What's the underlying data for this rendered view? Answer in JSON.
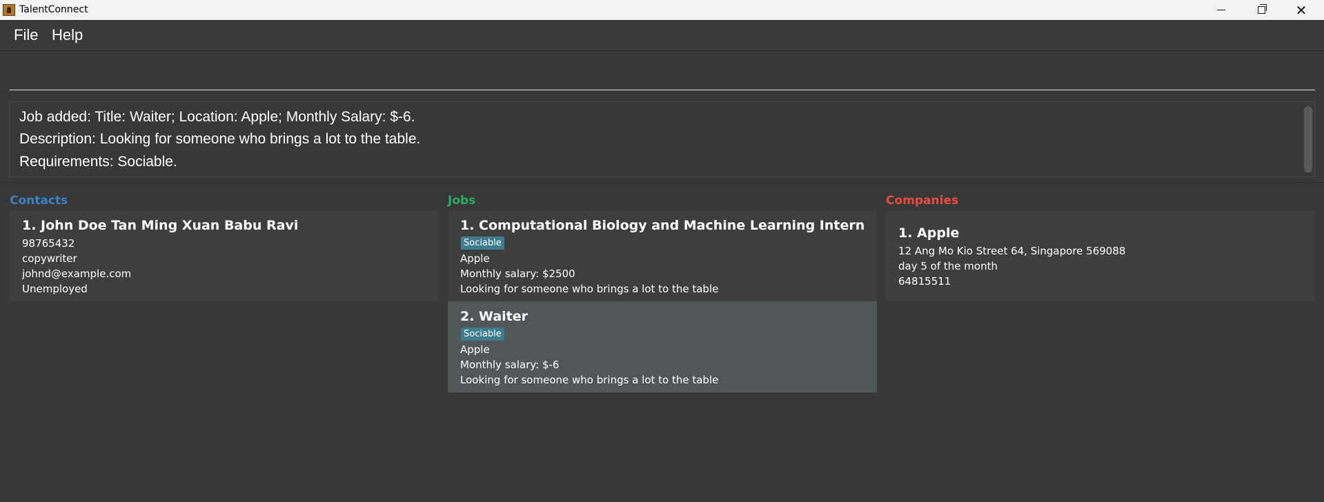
{
  "window": {
    "title": "TalentConnect",
    "controls": {
      "minimize": "—",
      "maximize": "",
      "close": "✕"
    }
  },
  "menu": {
    "file": "File",
    "help": "Help"
  },
  "command": {
    "value": "",
    "placeholder": ""
  },
  "result": {
    "lines": [
      "Job added: Title: Waiter; Location: Apple; Monthly Salary: $-6.",
      "Description: Looking for someone who brings a lot to the table.",
      "Requirements: Sociable."
    ]
  },
  "colors": {
    "contacts_title": "#3b82c4",
    "jobs_title": "#27ae60",
    "companies_title": "#e74c3c",
    "tag_bg": "#3e7b91",
    "selected_card": "#515659"
  },
  "contacts": {
    "title": "Contacts",
    "items": [
      {
        "name": "1. John Doe Tan Ming Xuan Babu Ravi",
        "phone": "98765432",
        "role": "copywriter",
        "email": "johnd@example.com",
        "status": "Unemployed"
      }
    ]
  },
  "jobs": {
    "title": "Jobs",
    "items": [
      {
        "name": "1. Computational Biology and Machine Learning Intern",
        "tag": "Sociable",
        "company": "Apple",
        "salary": "Monthly salary: $2500",
        "description": "Looking for someone who brings a lot to the table"
      },
      {
        "name": "2. Waiter",
        "tag": "Sociable",
        "company": "Apple",
        "salary": "Monthly salary: $-6",
        "description": "Looking for someone who brings a lot to the table"
      }
    ]
  },
  "companies": {
    "title": "Companies",
    "items": [
      {
        "name": "1. Apple",
        "address": "12 Ang Mo Kio Street 64, Singapore 569088",
        "billing": "day 5 of the month",
        "phone": "64815511"
      }
    ]
  }
}
